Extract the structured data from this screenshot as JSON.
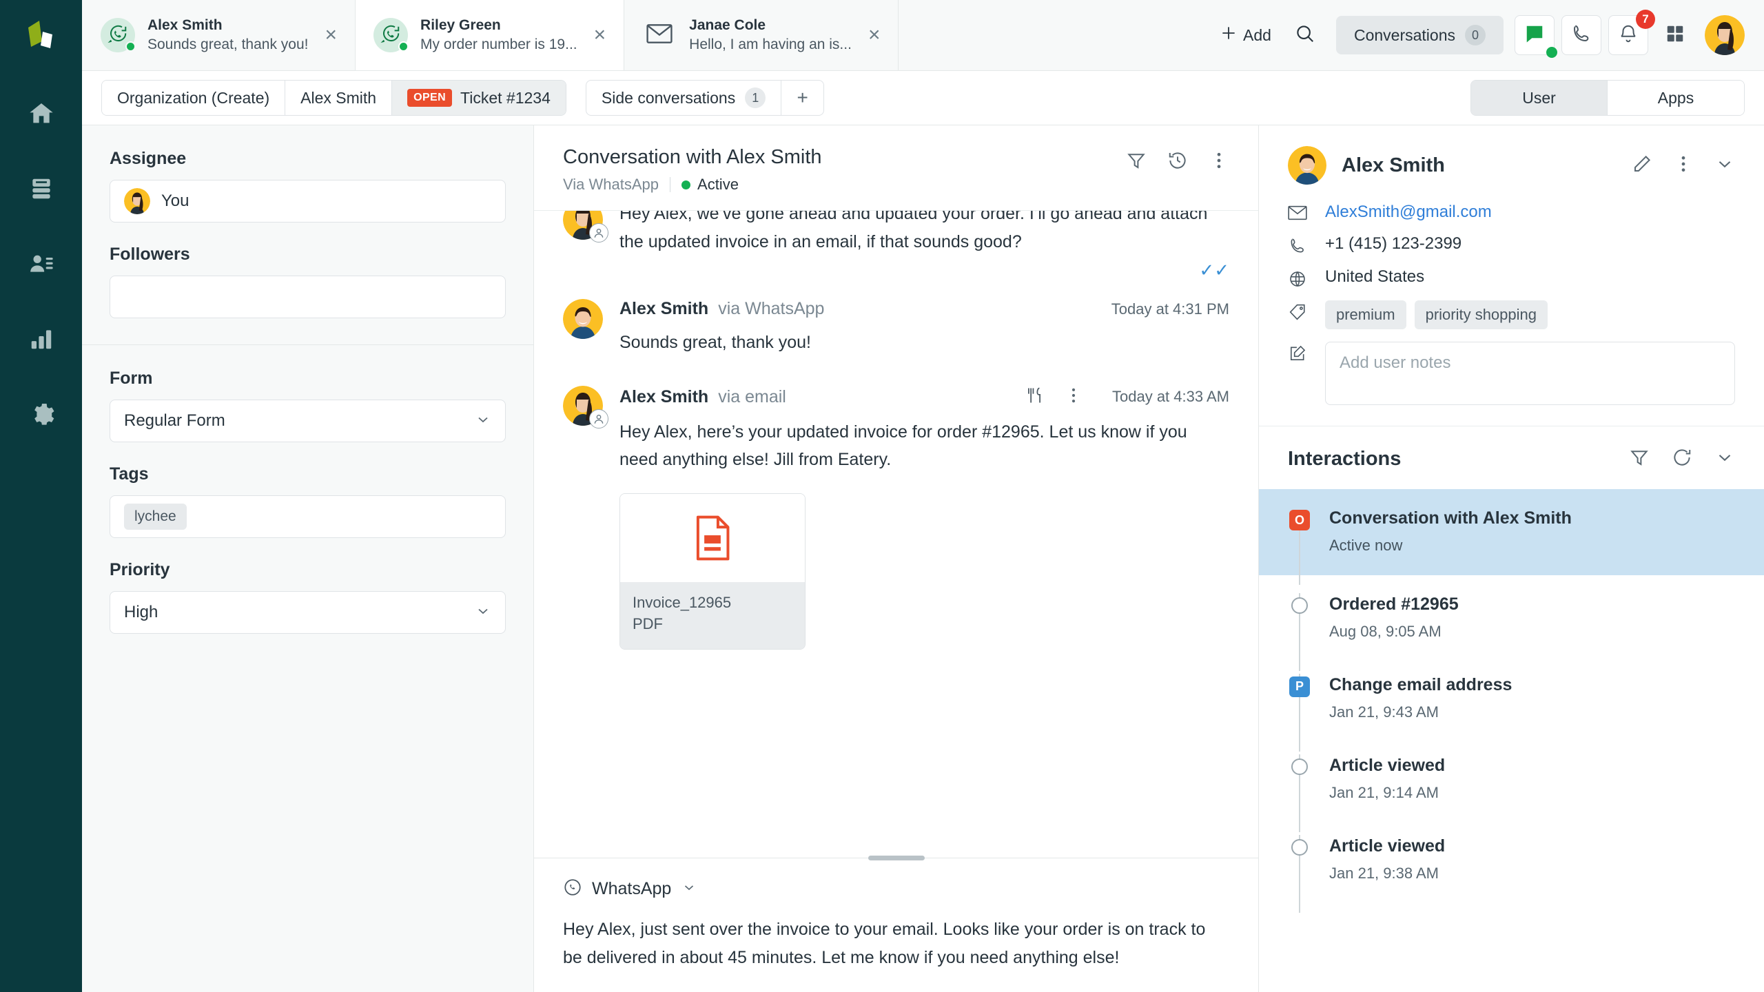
{
  "rail": {
    "logo_name": "app-logo",
    "items": [
      {
        "name": "home",
        "icon": "home-icon"
      },
      {
        "name": "inbox",
        "icon": "inbox-icon"
      },
      {
        "name": "contacts",
        "icon": "contacts-icon"
      },
      {
        "name": "reports",
        "icon": "bar-chart-icon"
      },
      {
        "name": "settings",
        "icon": "gear-icon"
      }
    ]
  },
  "topbar": {
    "conversation_tabs": [
      {
        "name": "Alex Smith",
        "preview": "Sounds great, thank you!",
        "channel": "whatsapp",
        "online": true,
        "active": false
      },
      {
        "name": "Riley Green",
        "preview": "My order number is 19...",
        "channel": "whatsapp",
        "online": true,
        "active": true
      },
      {
        "name": "Janae Cole",
        "preview": "Hello, I am having an is...",
        "channel": "email",
        "online": false,
        "active": false
      }
    ],
    "add_label": "Add",
    "search_icon": "search-icon",
    "queue_label": "Conversations",
    "queue_count": "0",
    "chat_badge": "",
    "notifications_count": "7"
  },
  "crumbbar": {
    "crumbs": [
      {
        "label": "Organization (Create)",
        "badge": ""
      },
      {
        "label": "Alex Smith",
        "badge": ""
      },
      {
        "label": "Ticket #1234",
        "badge": "OPEN"
      }
    ],
    "side_conversations_label": "Side conversations",
    "side_conversations_count": "1",
    "add_side_conversation": "+",
    "segment": [
      {
        "label": "User",
        "active": true
      },
      {
        "label": "Apps",
        "active": false
      }
    ]
  },
  "form_panel": {
    "assignee_label": "Assignee",
    "assignee_value": "You",
    "followers_label": "Followers",
    "followers_value": "",
    "form_label": "Form",
    "form_value": "Regular Form",
    "tags_label": "Tags",
    "tags": [
      "lychee"
    ],
    "priority_label": "Priority",
    "priority_value": "High"
  },
  "conversation": {
    "title": "Conversation with Alex Smith",
    "via": "Via WhatsApp",
    "status": "Active",
    "header_icons": [
      "filter-icon",
      "history-icon",
      "more-vertical-icon"
    ],
    "messages": [
      {
        "author": "",
        "via": "",
        "time": "",
        "text": "Hey Alex, we’ve gone ahead and updated your order. I’ll go ahead and attach the updated invoice in an email, if that sounds good?",
        "read_ticks": "✓✓",
        "avatar": "agent",
        "channel_badge": "user-circle-icon",
        "show_header": false
      },
      {
        "author": "Alex Smith",
        "via": "via WhatsApp",
        "time": "Today at 4:31 PM",
        "text": "Sounds great, thank you!",
        "read_ticks": "",
        "avatar": "alex",
        "channel_badge": "",
        "show_header": true
      },
      {
        "author": "Alex Smith",
        "via": "via email",
        "time": "Today at 4:33 AM",
        "text": "Hey Alex, here’s your updated invoice for order #12965. Let us know if you need anything else! Jill from Eatery.",
        "read_ticks": "",
        "avatar": "agent",
        "channel_badge": "user-circle-icon",
        "show_header": true,
        "header_icons": [
          "cutlery-icon",
          "more-vertical-icon"
        ],
        "attachment": {
          "filename": "Invoice_12965",
          "filetype": "PDF",
          "icon": "pdf-file-icon"
        }
      }
    ],
    "composer": {
      "channel": "WhatsApp",
      "channel_icon": "whatsapp-icon",
      "chevron": "chevron-down-icon",
      "text": "Hey Alex, just sent over the invoice to your email. Looks like your order is on track to be delivered in about 45 minutes. Let me know if you need anything else!"
    }
  },
  "right_panel": {
    "user_name": "Alex Smith",
    "header_icons": [
      "pencil-icon",
      "more-vertical-icon",
      "chevron-down-icon"
    ],
    "email": "AlexSmith@gmail.com",
    "phone": "+1 (415) 123-2399",
    "country": "United States",
    "tags": [
      "premium",
      "priority shopping"
    ],
    "notes_placeholder": "Add user notes",
    "interactions_title": "Interactions",
    "interactions_icons": [
      "filter-icon",
      "refresh-icon",
      "chevron-down-icon"
    ],
    "interactions": [
      {
        "title": "Conversation with Alex Smith",
        "time": "Active now",
        "marker": "o",
        "selected": true
      },
      {
        "title": "Ordered #12965",
        "time": "Aug 08, 9:05 AM",
        "marker": "dot",
        "selected": false
      },
      {
        "title": "Change email address",
        "time": "Jan 21, 9:43 AM",
        "marker": "p",
        "selected": false
      },
      {
        "title": "Article viewed",
        "time": "Jan 21, 9:14 AM",
        "marker": "dot",
        "selected": false
      },
      {
        "title": "Article viewed",
        "time": "Jan 21, 9:38 AM",
        "marker": "dot",
        "selected": false
      }
    ]
  },
  "colors": {
    "rail_bg": "#0a3a3e",
    "accent_orange": "#ea4d2c",
    "accent_green": "#14b053",
    "link_blue": "#2f7ed8",
    "select_blue": "#c9e1f2"
  }
}
